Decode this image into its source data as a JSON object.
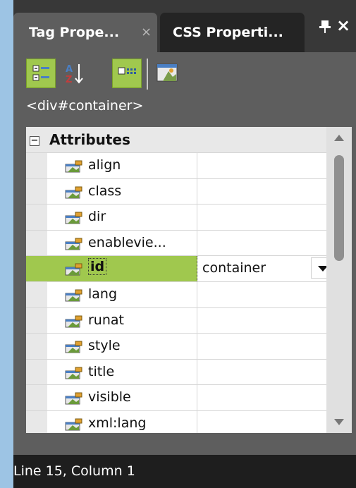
{
  "tabs": [
    {
      "label": "Tag Prope...",
      "close": "×"
    },
    {
      "label": "CSS Properti..."
    }
  ],
  "window_controls": {
    "pin": "pin-icon",
    "close": "×"
  },
  "toolbar": {
    "buttons": [
      "categorized-icon",
      "alphabetical-icon",
      "show-set-properties-icon",
      "properties-page-icon"
    ]
  },
  "tag_path": "<div#container>",
  "grid": {
    "category": {
      "toggle": "−",
      "label": "Attributes"
    },
    "rows": [
      {
        "name": "align",
        "value": ""
      },
      {
        "name": "class",
        "value": ""
      },
      {
        "name": "dir",
        "value": ""
      },
      {
        "name": "enablevie...",
        "value": ""
      },
      {
        "name": "id",
        "value": "container",
        "selected": true
      },
      {
        "name": "lang",
        "value": ""
      },
      {
        "name": "runat",
        "value": ""
      },
      {
        "name": "style",
        "value": ""
      },
      {
        "name": "title",
        "value": ""
      },
      {
        "name": "visible",
        "value": ""
      },
      {
        "name": "xml:lang",
        "value": ""
      }
    ]
  },
  "status": {
    "text": "Line 15, Column 1"
  },
  "colors": {
    "highlight": "#a0c84e",
    "panel": "#5e5e5e",
    "background": "#9dc4e4"
  }
}
